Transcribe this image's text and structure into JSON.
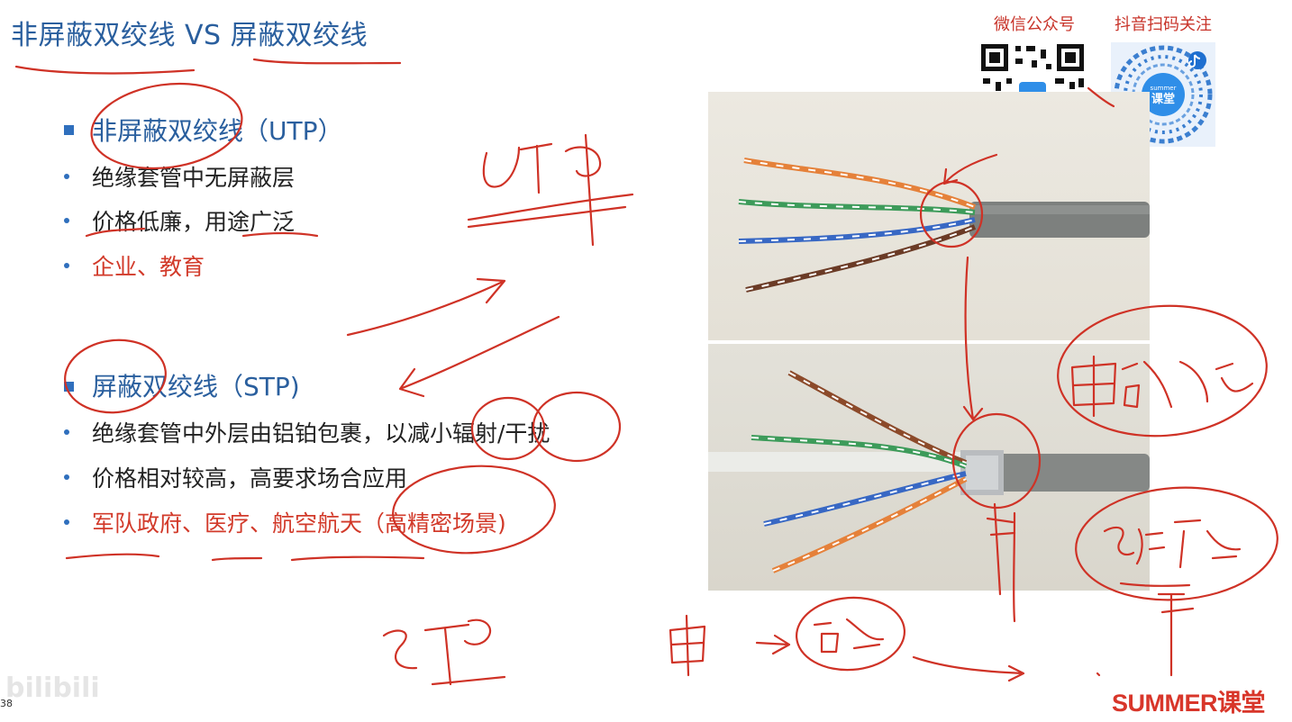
{
  "title": "非屏蔽双绞线 VS 屏蔽双绞线",
  "utp": {
    "heading": "非屏蔽双绞线（UTP）",
    "items": [
      "绝缘套管中无屏蔽层",
      "价格低廉，用途广泛",
      "企业、教育"
    ]
  },
  "stp": {
    "heading": "屏蔽双绞线（STP)",
    "items": [
      "绝缘套管中外层由铝铂包裹，以减小辐射/干扰",
      "价格相对较高，高要求场合应用",
      "军队政府、医疗、航空航天（高精密场景)"
    ]
  },
  "qr": {
    "wechat_label": "微信公众号",
    "douyin_label": "抖音扫码关注",
    "douyin_logo_text": "summer 课堂"
  },
  "brand": "SUMMER课堂",
  "page_number": "38",
  "watermark": "bilibili",
  "colors": {
    "title": "#2a5f9e",
    "accent": "#d8362a",
    "ink": "#d23a2a"
  }
}
